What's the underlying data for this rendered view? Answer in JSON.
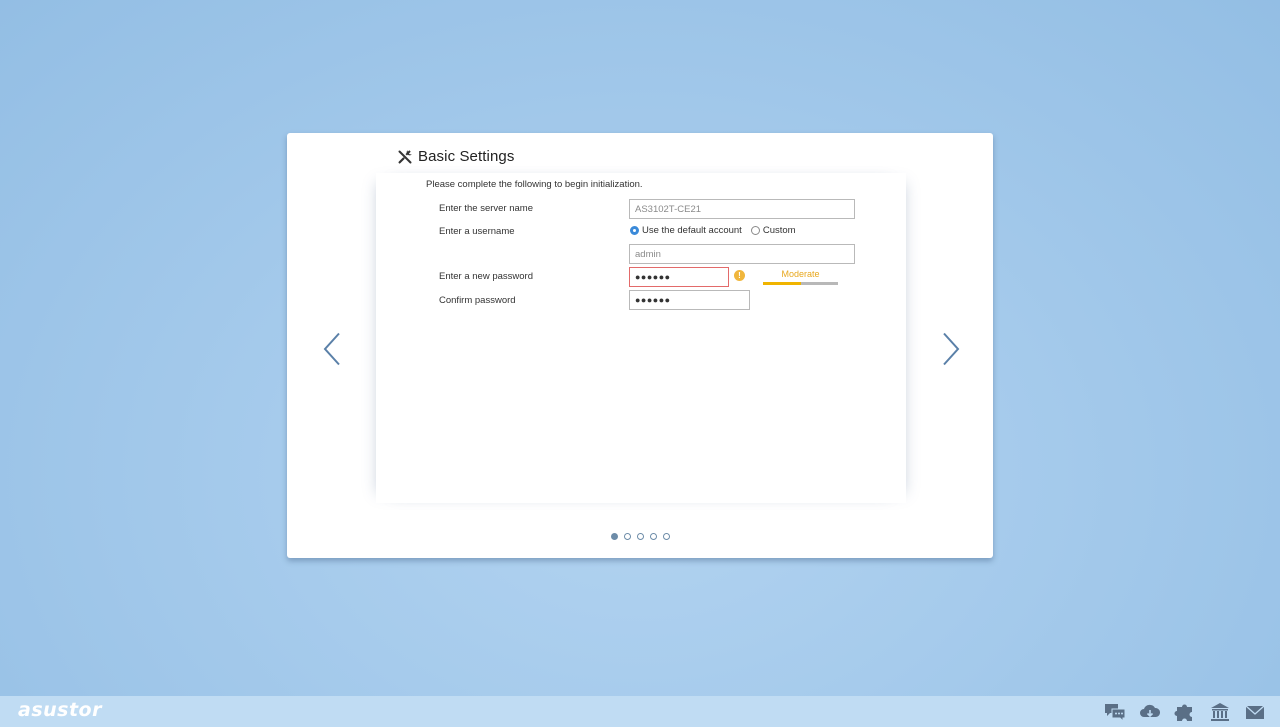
{
  "wizard": {
    "title": "Basic Settings",
    "subtitle": "Please complete the following to begin initialization."
  },
  "form": {
    "server_name": {
      "label": "Enter the server name",
      "value": "AS3102T-CE21"
    },
    "username": {
      "label": "Enter a username",
      "options": [
        "Use the default account",
        "Custom"
      ],
      "selected": "Use the default account",
      "value": "admin"
    },
    "password": {
      "label": "Enter a new password",
      "value": "●●●●●●"
    },
    "confirm": {
      "label": "Confirm password",
      "value": "●●●●●●"
    },
    "strength": {
      "label": "Moderate",
      "level": 0.5
    }
  },
  "pagination": {
    "total": 5,
    "current": 1
  },
  "taskbar": {
    "logo": "asustor",
    "icons": [
      "chat-icon",
      "cloud-download-icon",
      "puzzle-icon",
      "bank-icon",
      "mail-icon"
    ]
  },
  "colors": {
    "accent": "#3b8ad9",
    "error_border": "#e36a6a",
    "warning": "#f0b63c",
    "strength_fill": "#f0b400",
    "strength_text": "#e8a81e"
  }
}
